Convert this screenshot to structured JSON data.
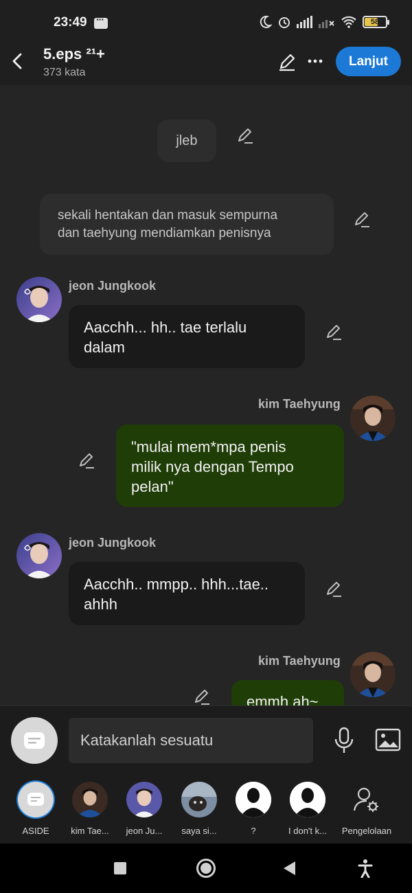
{
  "status_bar": {
    "time": "23:49",
    "battery": "58",
    "battery_level": 0.58
  },
  "header": {
    "title": "5.eps ²¹+",
    "subtitle": "373 kata",
    "continue_label": "Lanjut"
  },
  "chat": {
    "narration_1": "jleb",
    "narration_2": [
      "sekali hentakan dan masuk sempurna",
      "dan taehyung mendiamkan penisnya"
    ],
    "messages": [
      {
        "speaker": "jeon Jungkook",
        "lines": [
          "Aacchh... hh.. tae terlalu",
          "dalam"
        ]
      },
      {
        "speaker": "kim Taehyung",
        "lines": [
          "\"mulai mem*mpa penis",
          "milik nya dengan Tempo",
          "pelan\""
        ]
      },
      {
        "speaker": "jeon Jungkook",
        "lines": [
          "Aacchh.. mmpp.. hhh...tae..",
          "ahhh"
        ]
      },
      {
        "speaker": "kim Taehyung",
        "lines": [
          "emmh ah~"
        ]
      }
    ]
  },
  "input": {
    "placeholder": "Katakanlah sesuatu"
  },
  "characters": [
    {
      "label": "ASIDE"
    },
    {
      "label": "kim Tae..."
    },
    {
      "label": "jeon Ju..."
    },
    {
      "label": "saya si..."
    },
    {
      "label": "?"
    },
    {
      "label": "I don't k..."
    },
    {
      "label": "Pengelolaan"
    }
  ],
  "colors": {
    "accent": "#1c7ad6",
    "right_bubble": "#1f3d07",
    "left_bubble": "#1a1a1a"
  }
}
